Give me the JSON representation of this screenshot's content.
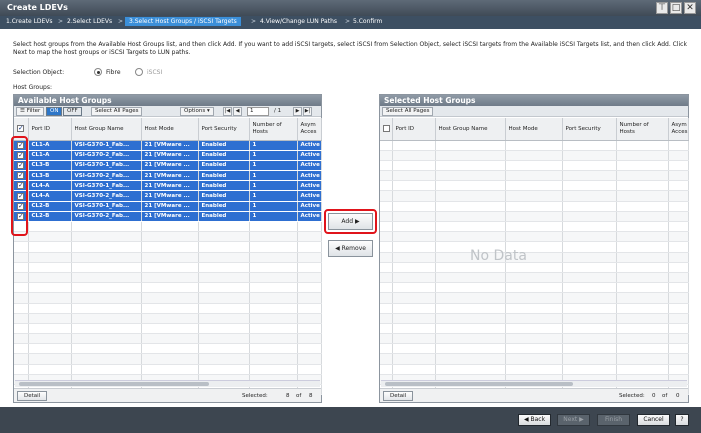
{
  "window": {
    "title": "Create LDEVs",
    "pin_glyph": "⊤",
    "maximize_glyph": "□",
    "close_glyph": "✕"
  },
  "steps": [
    {
      "label": "1.Create LDEVs"
    },
    {
      "label": "2.Select LDEVs"
    },
    {
      "label": "3.Select Host Groups / iSCSI Targets"
    },
    {
      "label": "4.View/Change LUN Paths"
    },
    {
      "label": "5.Confirm"
    }
  ],
  "step_separator": ">",
  "description": "Select host groups from the Available Host Groups list, and then click Add. If you want to add iSCSI targets, select iSCSI from Selection Object, select iSCSI targets from the Available iSCSI Targets list, and then click Add.  Click Next to map the host groups or iSCSI Targets to LUN paths.",
  "selection_object": {
    "label": "Selection Object:",
    "options": [
      "Fibre",
      "iSCSI"
    ],
    "selected": "Fibre"
  },
  "host_groups_label": "Host Groups:",
  "available": {
    "title": "Available Host Groups",
    "filter_label": "Filter",
    "on_label": "ON",
    "off_label": "OFF",
    "select_all_pages": "Select All Pages",
    "options_label": "Options",
    "page_current": "1",
    "page_total": "/ 1",
    "columns": [
      "Port ID",
      "Host Group Name",
      "Host Mode",
      "Port Security",
      "Number of Hosts",
      "Asym Acces"
    ],
    "rows": [
      [
        "CL1-A",
        "VSI-G370-1_Fab...",
        "21 [VMware ...",
        "Enabled",
        "1",
        "Active"
      ],
      [
        "CL1-A",
        "VSI-G370-2_Fab...",
        "21 [VMware ...",
        "Enabled",
        "1",
        "Active"
      ],
      [
        "CL3-B",
        "VSI-G370-1_Fab...",
        "21 [VMware ...",
        "Enabled",
        "1",
        "Active"
      ],
      [
        "CL3-B",
        "VSI-G370-2_Fab...",
        "21 [VMware ...",
        "Enabled",
        "1",
        "Active"
      ],
      [
        "CL4-A",
        "VSI-G370-1_Fab...",
        "21 [VMware ...",
        "Enabled",
        "1",
        "Active"
      ],
      [
        "CL4-A",
        "VSI-G370-2_Fab...",
        "21 [VMware ...",
        "Enabled",
        "1",
        "Active"
      ],
      [
        "CL2-B",
        "VSI-G370-1_Fab...",
        "21 [VMware ...",
        "Enabled",
        "1",
        "Active"
      ],
      [
        "CL2-B",
        "VSI-G370-2_Fab...",
        "21 [VMware ...",
        "Enabled",
        "1",
        "Active"
      ]
    ],
    "detail_label": "Detail",
    "selected_label": "Selected:",
    "selected_count": "8",
    "of_label": "of",
    "total_count": "8"
  },
  "middle": {
    "add_label": "Add ▶",
    "remove_label": "◀ Remove"
  },
  "selected_panel": {
    "title": "Selected Host Groups",
    "select_all_pages": "Select All Pages",
    "columns": [
      "Port ID",
      "Host Group Name",
      "Host Mode",
      "Port Security",
      "Number of Hosts",
      "Asym Acces"
    ],
    "no_data": "No Data",
    "detail_label": "Detail",
    "selected_label": "Selected:",
    "selected_count": "0",
    "of_label": "of",
    "total_count": "0"
  },
  "footer": {
    "back_label": "◀ Back",
    "next_label": "Next ▶",
    "finish_label": "Finish",
    "cancel_label": "Cancel",
    "help_label": "?"
  },
  "colors": {
    "accent": "#2e6fd1",
    "highlight": "#e0141b",
    "title_bar": "#4a5561"
  }
}
